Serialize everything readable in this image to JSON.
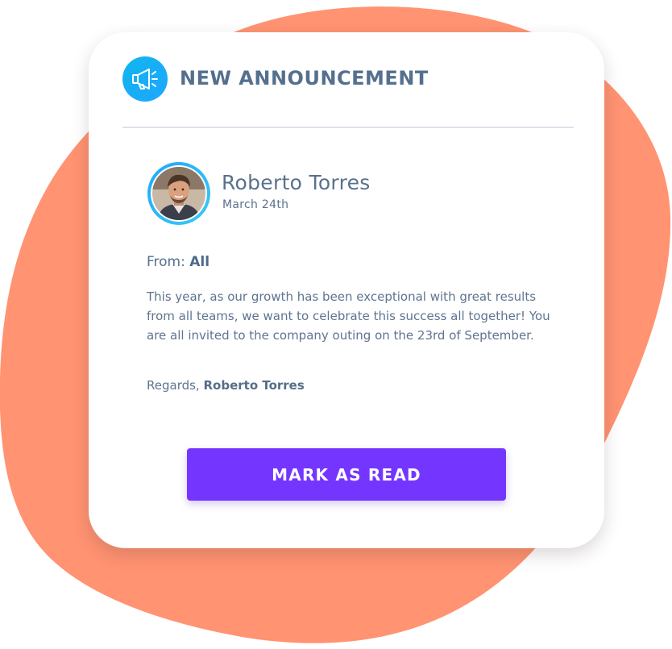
{
  "colors": {
    "blob": "#ff9372",
    "card": "#ffffff",
    "accent_icon": "#1ea7ff",
    "button": "#7436ff",
    "text": "#5a718d"
  },
  "announcement": {
    "icon": "megaphone-icon",
    "title": "NEW ANNOUNCEMENT"
  },
  "author": {
    "name": "Roberto Torres",
    "date": "March 24th"
  },
  "from": {
    "label": "From:",
    "value": "All"
  },
  "message": {
    "body": "This year, as our growth has been exceptional with great results from all teams, we want to celebrate this success all together! You are all invited to the company outing on the 23rd of September.",
    "regards_label": "Regards,",
    "regards_name": "Roberto Torres"
  },
  "actions": {
    "mark_as_read": "MARK AS READ"
  }
}
